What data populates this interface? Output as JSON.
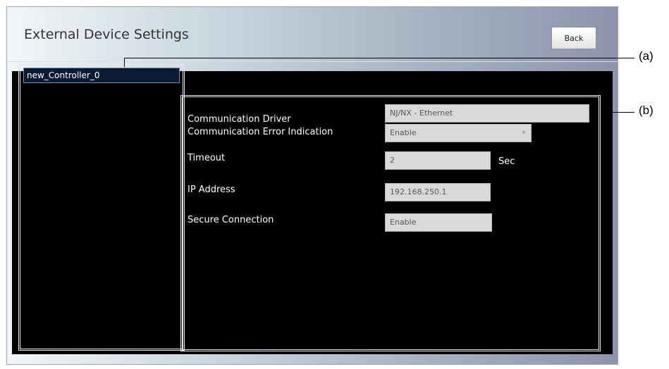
{
  "window": {
    "title": "External Device Settings",
    "back_label": "Back"
  },
  "device_list": {
    "items": [
      {
        "label": "new_Controller_0"
      }
    ]
  },
  "settings": {
    "rows": [
      {
        "label": "Communication Driver",
        "value": "NJ/NX - Ethernet"
      },
      {
        "label": "Communication Error Indication",
        "value": "Enable",
        "options_selected": "Enable"
      },
      {
        "label": "Timeout",
        "value": "2",
        "unit": "Sec"
      },
      {
        "label": "IP Address",
        "value": "192.168.250.1"
      },
      {
        "label": "Secure Connection",
        "value": "Enable"
      }
    ]
  },
  "callouts": {
    "a": "(a)",
    "b": "(b)"
  }
}
